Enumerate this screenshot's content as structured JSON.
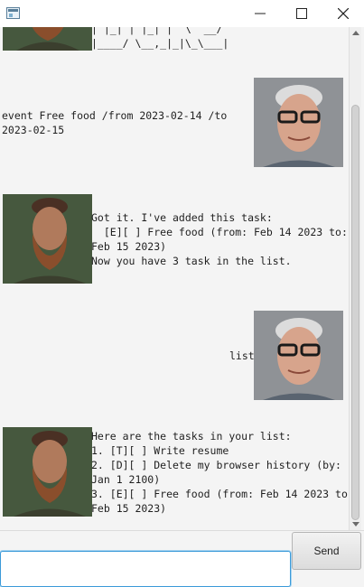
{
  "window": {
    "icon": "app-window-icon",
    "controls": {
      "minimize": "minimize-icon",
      "maximize": "maximize-icon",
      "close": "close-icon"
    }
  },
  "dialog": {
    "banner_bottom": "| |_| | |_| |  \\  __/\n|____/ \\__,_|_|\\_\\___|",
    "user_event": "event Free food /from 2023-02-14 /to\n2023-02-15",
    "bot_added": "Got it. I've added this task:\n  [E][ ] Free food (from: Feb 14 2023 to:\nFeb 15 2023)\nNow you have 3 task in the list.",
    "user_list": "list",
    "bot_list": "Here are the tasks in your list:\n1. [T][ ] Write resume\n2. [D][ ] Delete my browser history (by:\nJan 1 2100)\n3. [E][ ] Free food (from: Feb 14 2023 to:\nFeb 15 2023)"
  },
  "input": {
    "value": "",
    "placeholder": ""
  },
  "send": {
    "label": "Send"
  }
}
